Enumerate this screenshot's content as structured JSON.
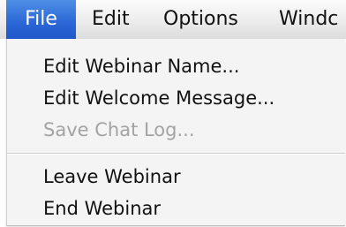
{
  "menubar": {
    "items": [
      {
        "label": "File"
      },
      {
        "label": "Edit"
      },
      {
        "label": "Options"
      },
      {
        "label": "Windc"
      }
    ],
    "active_index": 0
  },
  "file_menu": {
    "items": [
      {
        "label": "Edit Webinar Name...",
        "enabled": true
      },
      {
        "label": "Edit Welcome Message...",
        "enabled": true
      },
      {
        "label": "Save Chat Log...",
        "enabled": false
      },
      {
        "label": "Leave Webinar",
        "enabled": true
      },
      {
        "label": "End Webinar",
        "enabled": true
      }
    ]
  },
  "colors": {
    "active_menu_bg": "#2a66d6",
    "disabled_text": "#a3a3a3"
  }
}
